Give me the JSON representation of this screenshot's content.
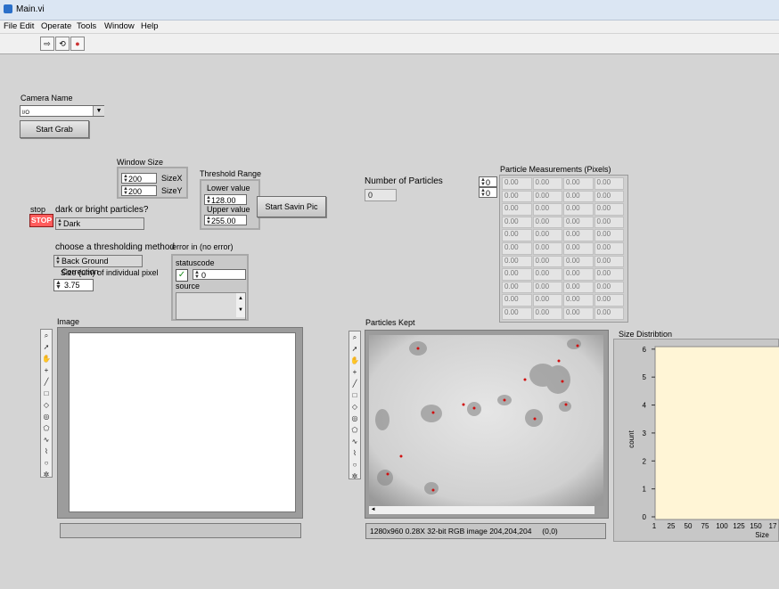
{
  "window": {
    "title": "Main.vi"
  },
  "menu": [
    "File",
    "Edit",
    "Operate",
    "Tools",
    "Window",
    "Help"
  ],
  "toolbar": {
    "run_icon": "run-arrow-icon",
    "run_cont_icon": "run-continuously-icon",
    "abort_icon": "abort-icon"
  },
  "camera": {
    "label": "Camera Name",
    "value": "",
    "prefix": "I/O",
    "start_grab": "Start Grab"
  },
  "window_size": {
    "label": "Window Size",
    "size_x": "200",
    "size_x_label": "SizeX",
    "size_y": "200",
    "size_y_label": "SizeY"
  },
  "threshold": {
    "label": "Threshold Range",
    "lower_label": "Lower value",
    "lower_value": "128.00",
    "upper_label": "Upper value",
    "upper_value": "255.00",
    "start_savin": "Start Savin Pic"
  },
  "particles": {
    "number_label": "Number of Particles",
    "number_value": "0",
    "measurements_label": "Particle Measurements (Pixels)",
    "row_index": "0",
    "col_index": "0",
    "cell_value": "0.00",
    "rows": 11,
    "cols": 4
  },
  "stop": {
    "label": "stop",
    "button": "STOP"
  },
  "dark_bright": {
    "label": "dark or bright particles?",
    "value": "Dark"
  },
  "threshold_method": {
    "label": "choose a thresholding method",
    "value": "Back Ground Correction"
  },
  "pixel_size": {
    "label": "Size (um) of individual pixel",
    "value": "3.75"
  },
  "error_in": {
    "label": "error in (no error)",
    "status_label": "status",
    "code_label": "code",
    "code_value": "0",
    "source_label": "source",
    "status_icon": "checkmark-icon"
  },
  "image": {
    "label": "Image"
  },
  "particles_kept": {
    "label": "Particles Kept",
    "status": "1280x960 0.28X 32-bit RGB image 204,204,204     (0,0)"
  },
  "size_dist": {
    "label": "Size Distribtion",
    "xlabel": "Size",
    "ylabel": "count",
    "x_ticks": [
      "1",
      "25",
      "50",
      "75",
      "100",
      "125",
      "150",
      "17"
    ],
    "y_ticks": [
      "0",
      "1",
      "2",
      "3",
      "4",
      "5",
      "6"
    ],
    "plot_bg": "#fff5d6"
  },
  "palette_tools": [
    "zoom-icon",
    "pointer-icon",
    "pan-icon",
    "point-icon",
    "line-icon",
    "rectangle-icon",
    "rotated-rect-icon",
    "annulus-icon",
    "polygon-icon",
    "freehand-icon",
    "broken-line-icon",
    "oval-icon",
    "magic-icon"
  ]
}
